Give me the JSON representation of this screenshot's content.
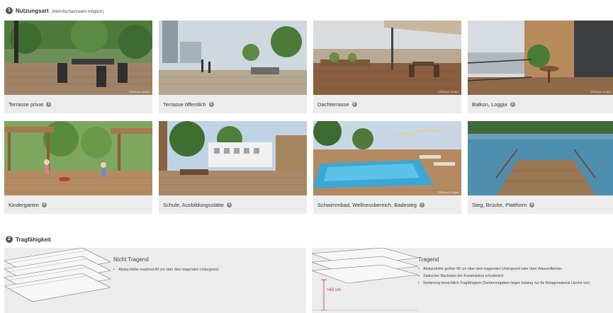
{
  "section1": {
    "number": "1",
    "title": "Nutzungsart",
    "subtitle": "(Mehrfachauswahl möglich)",
    "info_icon": "info-circle-icon",
    "cards": [
      {
        "label": "Terrasse privat",
        "credit": "©Fiberon GmbH"
      },
      {
        "label": "Terrasse öffentlich",
        "credit": ""
      },
      {
        "label": "Dachterrasse",
        "credit": "©Fiberon GmbH"
      },
      {
        "label": "Balkon, Loggia",
        "credit": "©Fiberon GmbH"
      },
      {
        "label": "Kindergarten",
        "credit": ""
      },
      {
        "label": "Schule, Ausbildungsstätte",
        "credit": ""
      },
      {
        "label": "Schwimmbad, Wellnessbereich, Badesteg",
        "credit": "©Fiberon GmbH"
      },
      {
        "label": "Steg, Brücke, Plattform",
        "credit": ""
      }
    ]
  },
  "section2": {
    "number": "2",
    "title": "Tragfähigkeit",
    "options": [
      {
        "title": "Nicht Tragend",
        "bullets": [
          "Absturzhöhe maximal 60 cm über dem tragenden Untergrund"
        ]
      },
      {
        "title": "Tragend",
        "height_label": ">60 cm",
        "bullets": [
          "Absturzhöhe größer 60 cm über dem tragenden Untergrund oder über Wasserflächen",
          "Statischer Nachweis der Konstruktion erforderlich",
          "Sortierung hinsichtlich Tragfähigkeit (Sortiervorgaben liegen bislang nur für Belagsmaterial Lärche vor)"
        ]
      }
    ]
  },
  "colors": {
    "card_bg": "#ececec",
    "step_badge": "#555555",
    "info_badge": "#8a8a8a",
    "accent_red": "#c0392b"
  }
}
